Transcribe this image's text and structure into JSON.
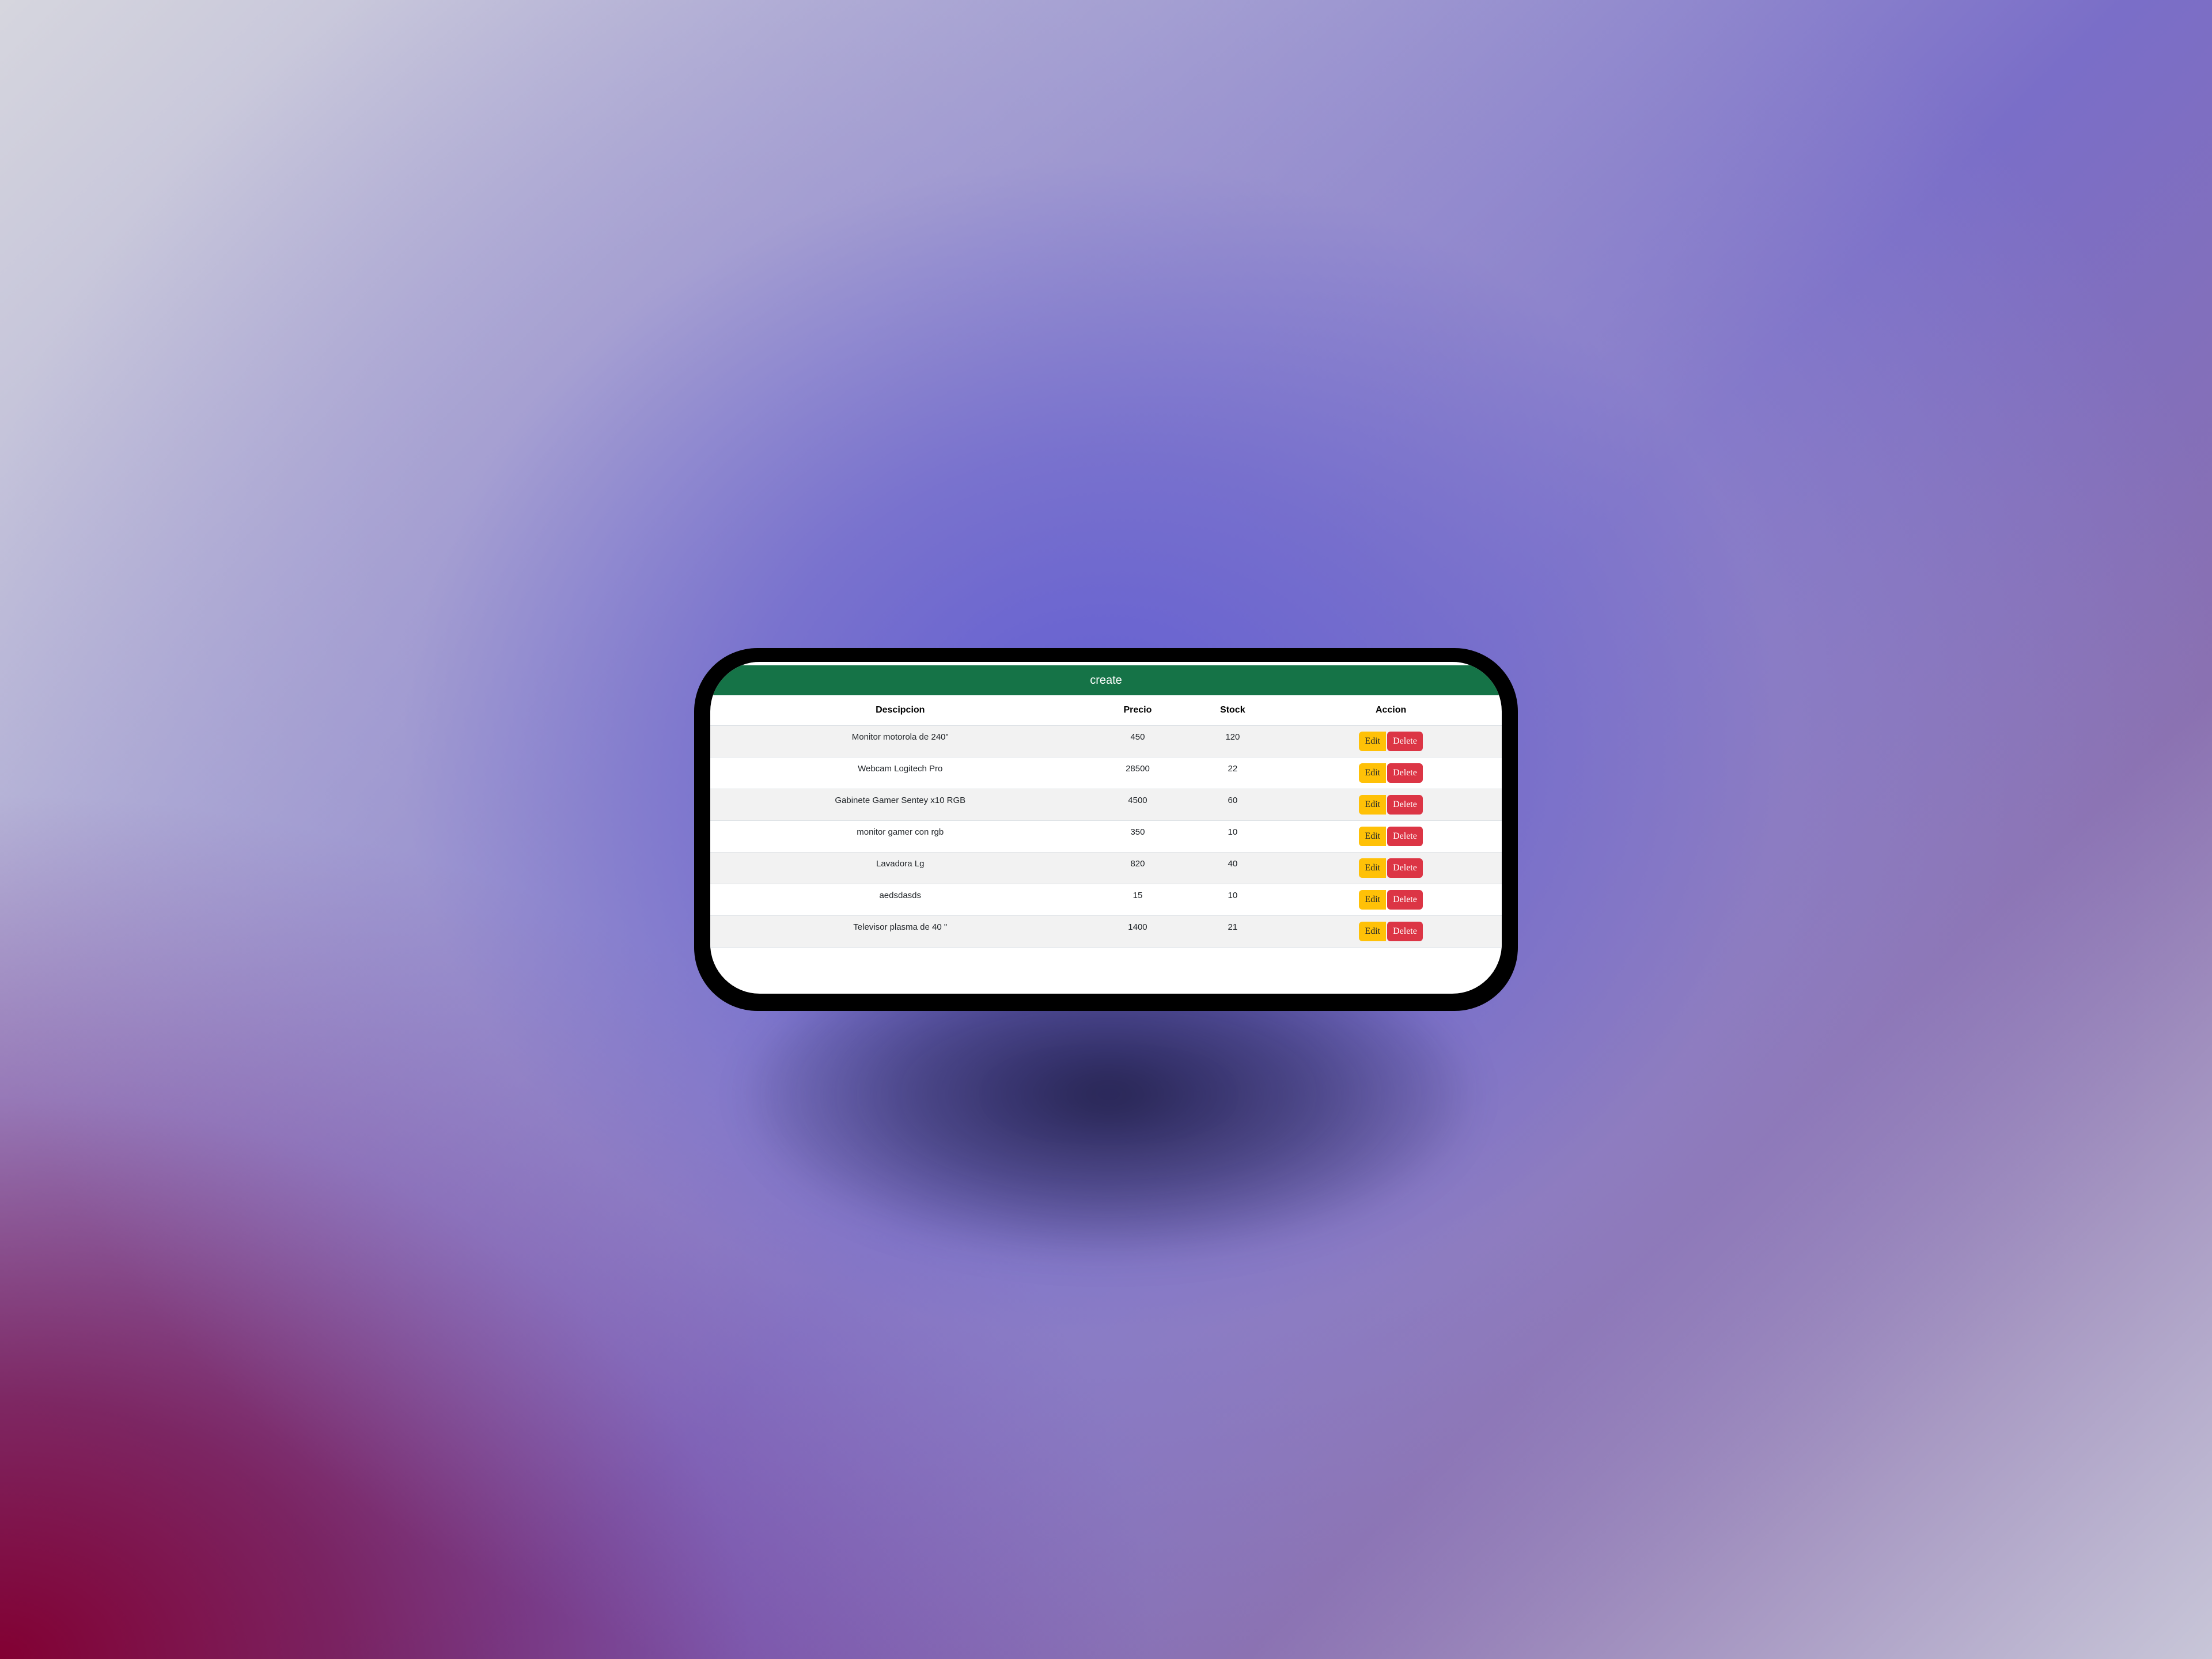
{
  "header": {
    "create_label": "create"
  },
  "table": {
    "columns": [
      "Descipcion",
      "Precio",
      "Stock",
      "Accion"
    ],
    "rows": [
      {
        "desc": "Monitor motorola de 240\"",
        "price": "450",
        "stock": "120"
      },
      {
        "desc": "Webcam Logitech Pro",
        "price": "28500",
        "stock": "22"
      },
      {
        "desc": "Gabinete Gamer Sentey x10 RGB",
        "price": "4500",
        "stock": "60"
      },
      {
        "desc": "monitor gamer con rgb",
        "price": "350",
        "stock": "10"
      },
      {
        "desc": "Lavadora Lg",
        "price": "820",
        "stock": "40"
      },
      {
        "desc": "aedsdasds",
        "price": "15",
        "stock": "10"
      },
      {
        "desc": "Televisor plasma de 40 \"",
        "price": "1400",
        "stock": "21"
      }
    ],
    "edit_label": "Edit",
    "delete_label": "Delete"
  },
  "colors": {
    "create_bar": "#157347",
    "edit_button": "#ffc107",
    "delete_button": "#dc3545"
  }
}
